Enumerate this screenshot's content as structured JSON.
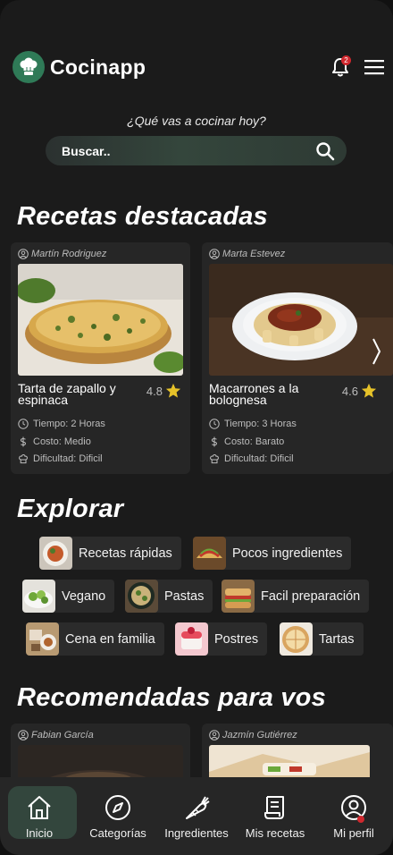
{
  "app": {
    "name": "Cocinapp"
  },
  "notifications": {
    "count": "2"
  },
  "question": "¿Qué vas a cocinar hoy?",
  "search": {
    "placeholder": "Buscar.."
  },
  "featured": {
    "title": "Recetas destacadas",
    "cards": [
      {
        "author": "Martín Rodriguez",
        "name": "Tarta de zapallo y espinaca",
        "rating": "4.8",
        "time": "Tiempo: 2 Horas",
        "cost": "Costo: Medio",
        "difficulty": "Dificultad: Dificil"
      },
      {
        "author": "Marta Estevez",
        "name": "Macarrones a la bolognesa",
        "rating": "4.6",
        "time": "Tiempo: 3 Horas",
        "cost": "Costo: Barato",
        "difficulty": "Dificultad: Dificil"
      }
    ]
  },
  "explore": {
    "title": "Explorar",
    "chips": [
      "Recetas rápidas",
      "Pocos ingredientes",
      "Vegano",
      "Pastas",
      "Facil preparación",
      "Cena en familia",
      "Postres",
      "Tartas"
    ]
  },
  "recommended": {
    "title": "Recomendadas para vos",
    "cards": [
      {
        "author": "Fabian García"
      },
      {
        "author": "Jazmín Gutiérrez"
      }
    ]
  },
  "nav": [
    {
      "label": "Inicio",
      "icon": "home-icon",
      "active": true
    },
    {
      "label": "Categorías",
      "icon": "compass-icon"
    },
    {
      "label": "Ingredientes",
      "icon": "carrot-icon"
    },
    {
      "label": "Mis recetas",
      "icon": "recipe-scroll-icon"
    },
    {
      "label": "Mi perfil",
      "icon": "profile-icon"
    }
  ],
  "colors": {
    "background": "#1b1b1b",
    "card": "#262626",
    "accent": "#2f7a57",
    "active_nav": "#33463d",
    "star": "#e6c229",
    "badge": "#d0282e"
  }
}
